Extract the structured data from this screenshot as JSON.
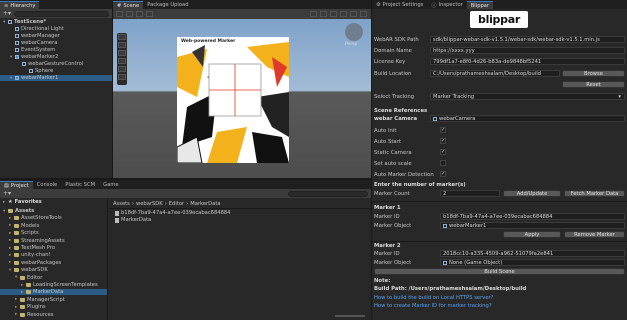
{
  "hierarchy": {
    "tab": "Hierarchy",
    "scene": "TestScene*",
    "items": [
      {
        "label": "TestScene*",
        "depth": 0,
        "type": "scene",
        "selected": false
      },
      {
        "label": "Directional Light",
        "depth": 1,
        "type": "go",
        "selected": false
      },
      {
        "label": "webarManager",
        "depth": 1,
        "type": "go",
        "selected": false
      },
      {
        "label": "webarCamera",
        "depth": 1,
        "type": "go",
        "selected": false
      },
      {
        "label": "EventSystem",
        "depth": 1,
        "type": "go",
        "selected": false
      },
      {
        "label": "webarMarker2",
        "depth": 1,
        "type": "blue",
        "selected": false
      },
      {
        "label": "webarGestureControl",
        "depth": 2,
        "type": "go",
        "selected": false
      },
      {
        "label": "Sphere",
        "depth": 3,
        "type": "go",
        "selected": false
      },
      {
        "label": "webarMarker1",
        "depth": 1,
        "type": "blue",
        "selected": true
      }
    ]
  },
  "scene_view": {
    "tabs": [
      "Scene",
      "Package Upload"
    ],
    "active_tab": "Scene",
    "persp_label": "Persp",
    "marker_caption": "Web-powered Marker"
  },
  "project": {
    "tabs": [
      "Project",
      "Console",
      "Plastic SCM",
      "Game"
    ],
    "favorites": "Favorites",
    "breadcrumb": [
      "Assets",
      "webarSDK",
      "Editor",
      "MarkerData"
    ],
    "tree": [
      {
        "label": "Assets",
        "depth": 0
      },
      {
        "label": "AssetStoreTools",
        "depth": 1
      },
      {
        "label": "Models",
        "depth": 1
      },
      {
        "label": "Scripts",
        "depth": 1
      },
      {
        "label": "StreamingAssets",
        "depth": 1
      },
      {
        "label": "TextMesh Pro",
        "depth": 1
      },
      {
        "label": "unity-chan!",
        "depth": 1
      },
      {
        "label": "webarPackages",
        "depth": 1
      },
      {
        "label": "webarSDK",
        "depth": 1
      },
      {
        "label": "Editor",
        "depth": 2
      },
      {
        "label": "LoadingScreenTemplates",
        "depth": 3
      },
      {
        "label": "MarkerData",
        "depth": 3
      },
      {
        "label": "ManagerScript",
        "depth": 2
      },
      {
        "label": "Plugins",
        "depth": 2
      },
      {
        "label": "Resources",
        "depth": 2
      }
    ],
    "files": [
      "b18df-7ba9-47a4-a7ee-039ecabac684884",
      "MarkerData"
    ]
  },
  "right_panel": {
    "tabs": [
      "Project Settings",
      "Inspector",
      "Blippar"
    ],
    "active_tab": "Blippar",
    "logo": "blippar",
    "fields": {
      "sdk_path_label": "WebAR SDK Path",
      "sdk_path_value": "sdk/blippar-webar-sdk-v1.5.1/webar-sdk/webar-sdk-v1.5.1.min.js",
      "domain_label": "Domain Name",
      "domain_value": "https://xxxx.yyy",
      "license_label": "License Key",
      "license_value": "799df1a7-e8f0-4d26-b83a-de9848bf5241",
      "build_location_label": "Build Location",
      "build_location_value": "C:/Users/prathameshsalam/Desktop/build",
      "browse": "Browse",
      "reset": "Reset",
      "tracking_label": "Select Tracking",
      "tracking_value": "Marker Tracking",
      "scene_refs": "Scene References",
      "webar_camera_label": "webar Camera",
      "webar_camera_value": "webarCamera",
      "auto_init": "Auto Init",
      "auto_start": "Auto Start",
      "static_camera": "Static Camera",
      "set_auto_scale": "Set auto scale",
      "auto_marker_detection": "Auto Marker Detection",
      "enter_markers": "Enter the number of marker(s)",
      "marker_count_label": "Marker Count",
      "marker_count_value": "2",
      "add_update": "Add/Update",
      "fetch_marker_data": "Fetch Marker Data",
      "marker1_title": "Marker 1",
      "marker1_id_label": "Marker ID",
      "marker1_id_value": "b18df-7ba9-47a4-a7ee-039ecabac684884",
      "marker1_obj_label": "Marker Object",
      "marker1_obj_value": "webarMarker1",
      "apply": "Apply",
      "remove_marker": "Remove Marker",
      "marker2_title": "Marker 2",
      "marker2_id_label": "Marker ID",
      "marker2_id_value": "2018cc10-a335-4509-a962-51079fa2e841",
      "marker2_obj_label": "Marker Object",
      "marker2_obj_value": "None (Game Object)",
      "build_scene": "Build Scene",
      "note": "Note:",
      "build_path": "Build Path: /Users/prathameshsalam/Desktop/build",
      "link1": "How to build the build on Local HTTPS server?",
      "link2": "How to create Marker ID for marker tracking?"
    },
    "checks": {
      "auto_init": true,
      "auto_start": true,
      "static_camera": true,
      "set_auto_scale": false,
      "auto_marker_detection": true
    }
  },
  "colors": {
    "accent": "#3a79bb",
    "selected_row": "#2c5d87",
    "link": "#5aa2f0",
    "scene_sky": "#7fa2c9",
    "scene_ground": "#4d4d4d"
  }
}
